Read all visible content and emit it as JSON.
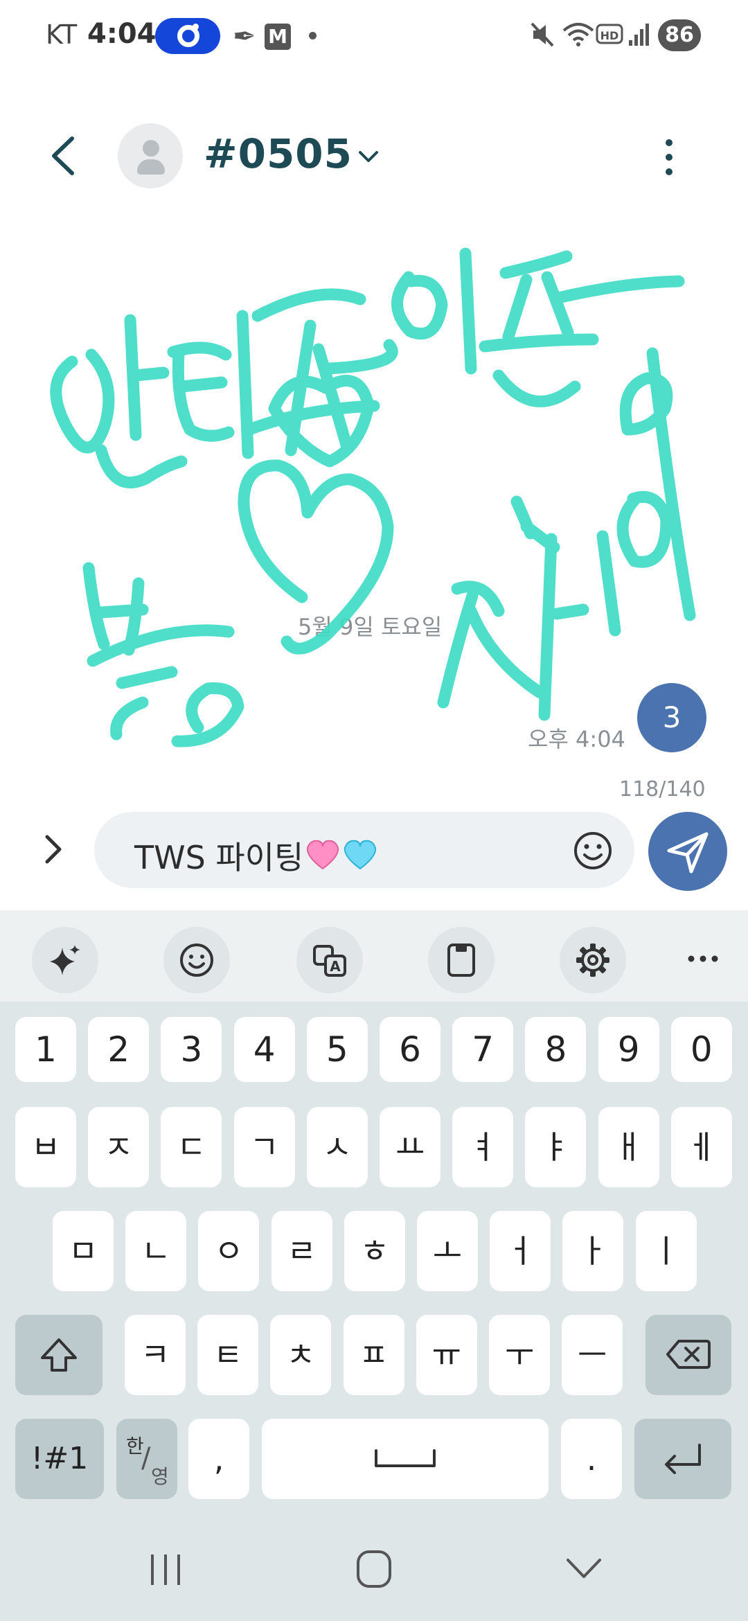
{
  "status_bar": {
    "carrier": "KT",
    "time": "4:04",
    "battery": "86",
    "icons": [
      "brand-pill-icon",
      "feather-icon",
      "m-app-icon",
      "dot-icon",
      "mute-icon",
      "wifi-icon",
      "hd-icon",
      "signal-icon",
      "battery-icon"
    ]
  },
  "header": {
    "title": "#0505",
    "icons": [
      "back-arrow-icon",
      "avatar-person-icon",
      "chevron-down-icon",
      "more-vertical-icon"
    ]
  },
  "chat": {
    "date_separator": "5월 9일 토요일",
    "message_time": "오후 4:04",
    "unread_count": "3",
    "char_counter": "118/140",
    "doodle_color": "#3fdcc6"
  },
  "input": {
    "text": "TWS 파이팅",
    "icons": [
      "expand-chevron-icon",
      "pink-heart-icon",
      "blue-heart-icon",
      "emoji-icon",
      "send-icon"
    ],
    "accent": "#4a73b0"
  },
  "keyboard": {
    "toolbar_icons": [
      "ai-sparkle-icon",
      "emoji-icon",
      "translate-icon",
      "clipboard-icon",
      "settings-gear-icon",
      "more-horizontal-icon"
    ],
    "number_row": [
      "1",
      "2",
      "3",
      "4",
      "5",
      "6",
      "7",
      "8",
      "9",
      "0"
    ],
    "row1": [
      "ㅂ",
      "ㅈ",
      "ㄷ",
      "ㄱ",
      "ㅅ",
      "ㅛ",
      "ㅕ",
      "ㅑ",
      "ㅐ",
      "ㅔ"
    ],
    "row2": [
      "ㅁ",
      "ㄴ",
      "ㅇ",
      "ㄹ",
      "ㅎ",
      "ㅗ",
      "ㅓ",
      "ㅏ",
      "ㅣ"
    ],
    "row3": [
      "ㅋ",
      "ㅌ",
      "ㅊ",
      "ㅍ",
      "ㅠ",
      "ㅜ",
      "ㅡ"
    ],
    "symbols_key": "!#1",
    "lang_key_top": "한",
    "lang_key_bottom": "영",
    "comma_key": ",",
    "period_key": "."
  },
  "nav_bar": {
    "icons": [
      "recent-apps-icon",
      "home-icon",
      "back-down-icon"
    ]
  }
}
